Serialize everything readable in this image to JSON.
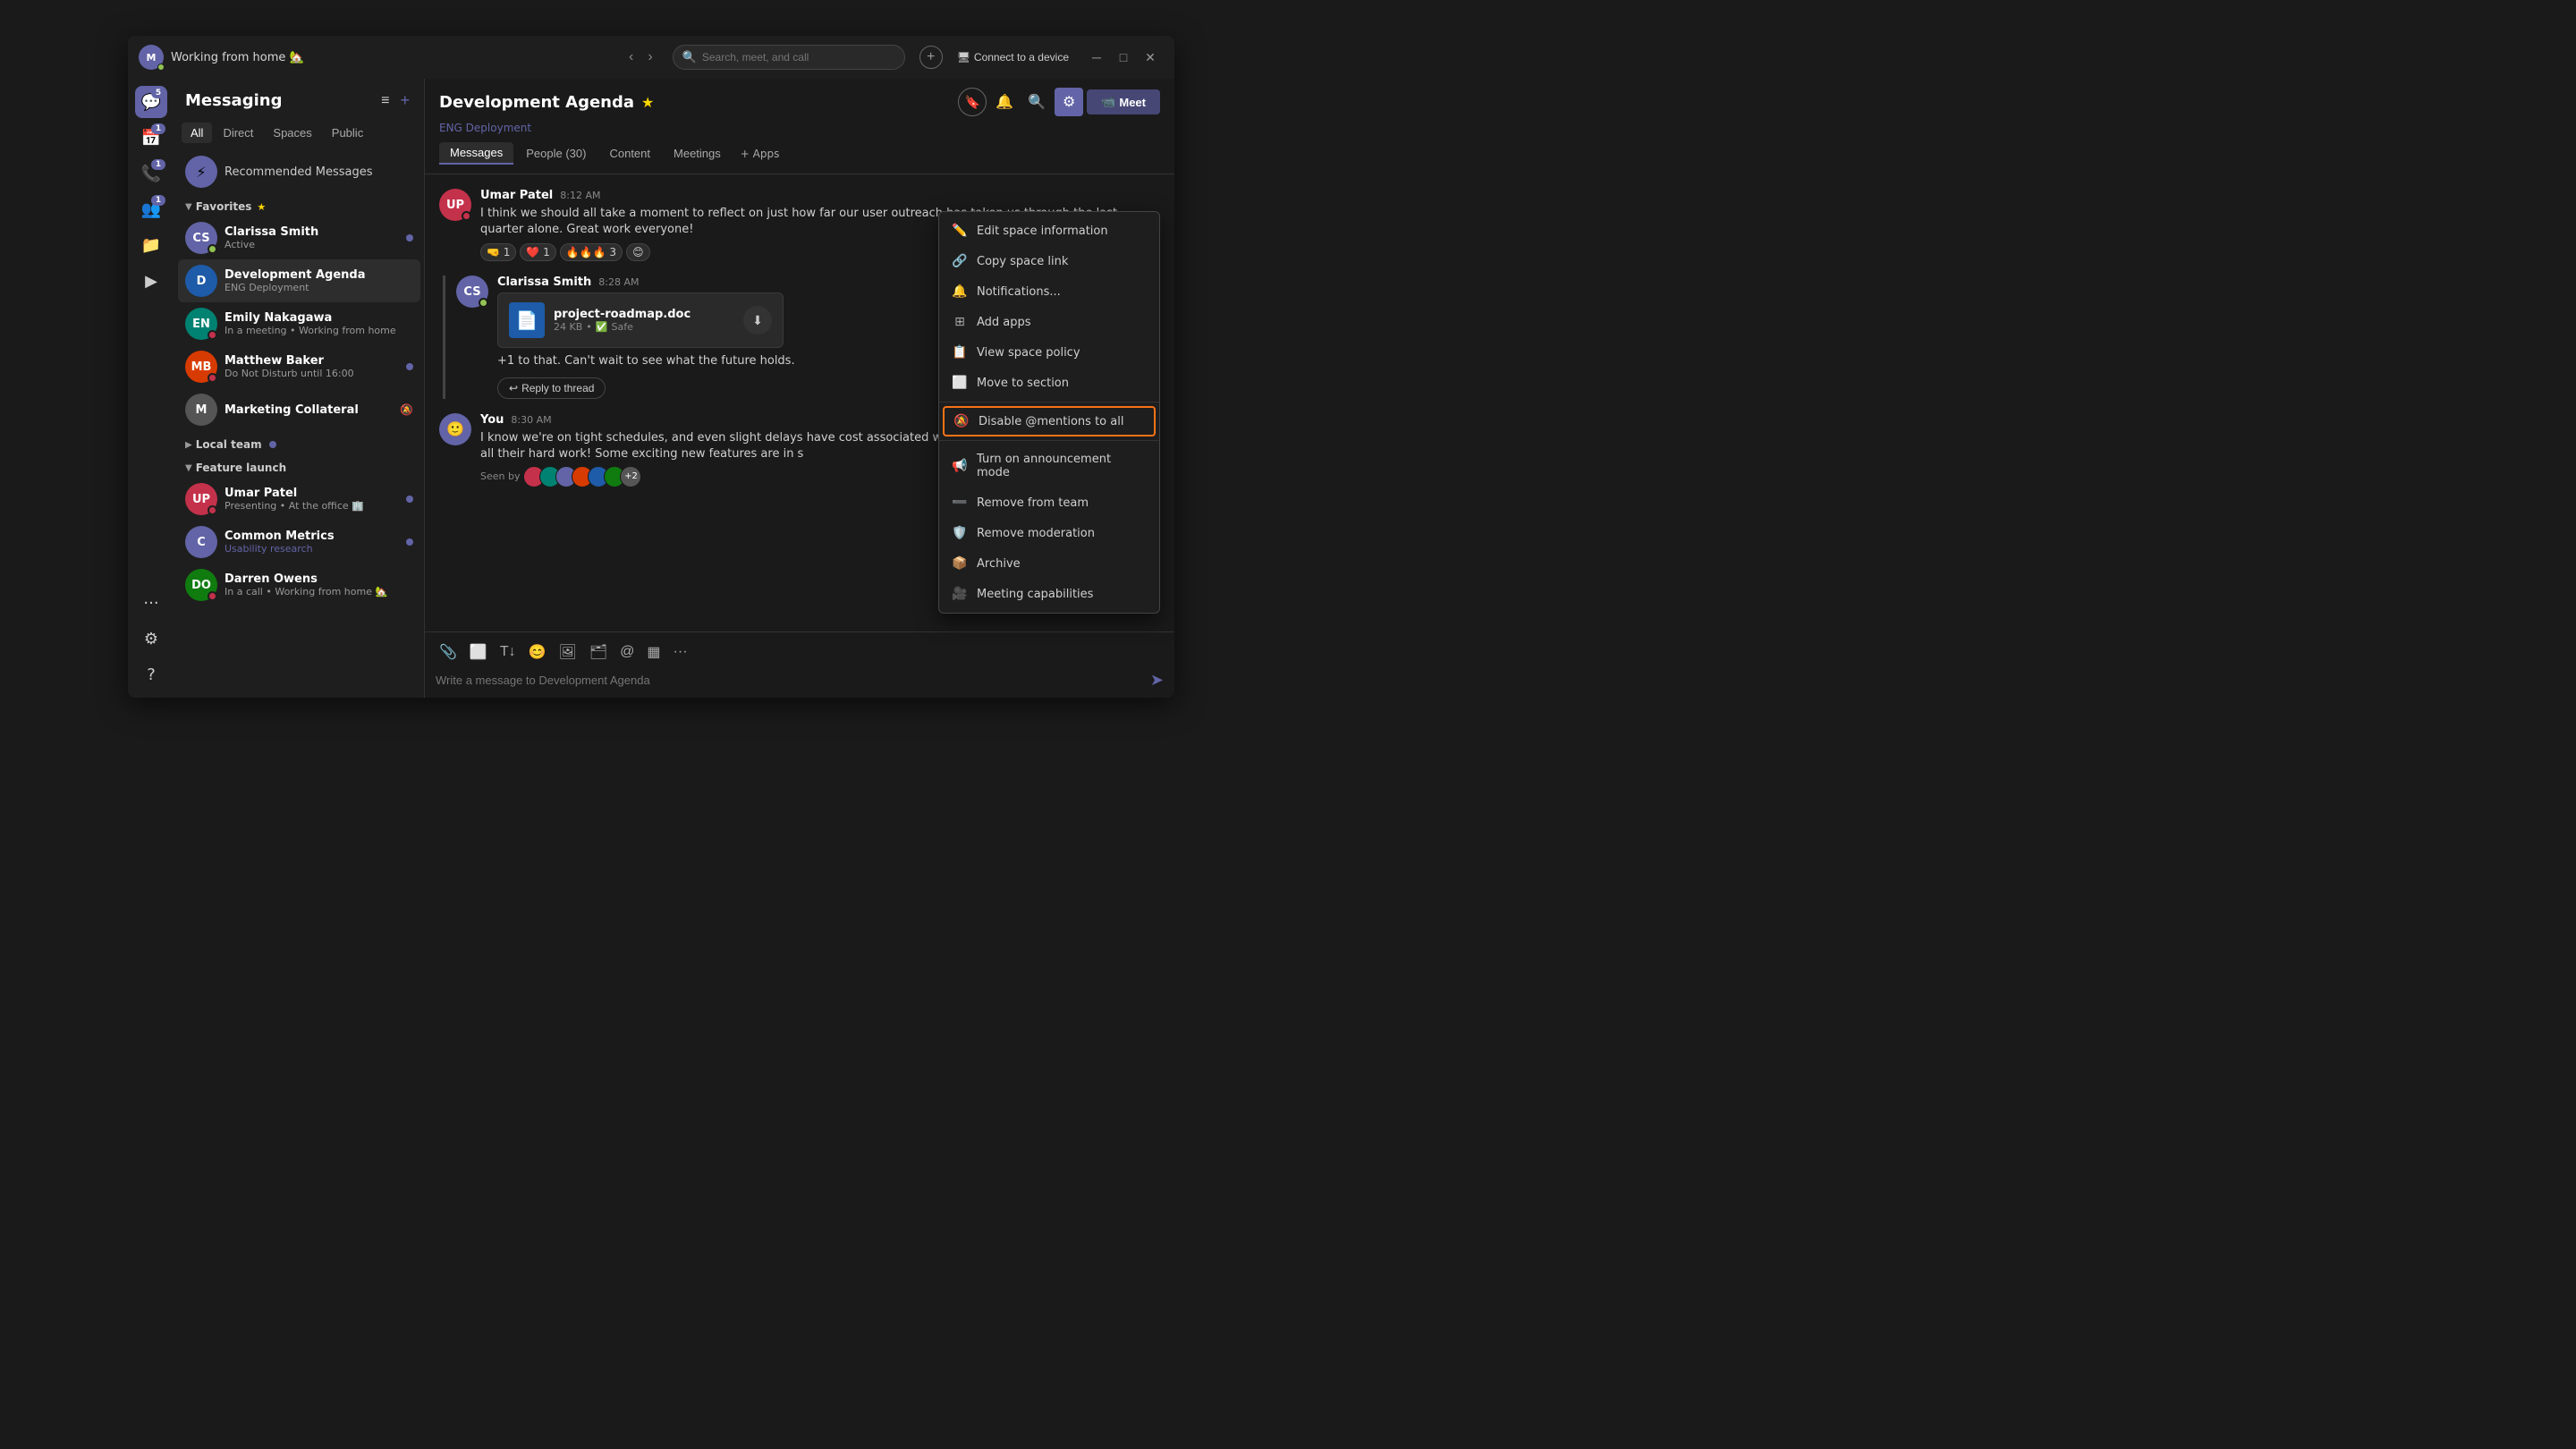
{
  "app": {
    "title": "Working from home 🏡",
    "window_controls": [
      "minimize",
      "maximize",
      "close"
    ],
    "search_placeholder": "Search, meet, and call",
    "connect_device": "Connect to a device"
  },
  "sidebar": {
    "title": "Messaging",
    "tabs": [
      "All",
      "Direct",
      "Spaces",
      "Public"
    ],
    "active_tab": "All",
    "sections": {
      "favorites": {
        "label": "Favorites",
        "expanded": true,
        "star": true
      },
      "local_team": {
        "label": "Local team",
        "expanded": false,
        "has_badge": true
      },
      "feature_launch": {
        "label": "Feature launch",
        "expanded": true
      }
    },
    "recommended": {
      "icon": "⚡",
      "label": "Recommended Messages"
    },
    "items": [
      {
        "id": "clarissa",
        "name": "Clarissa Smith",
        "sub": "Active",
        "avatar_initials": "CS",
        "avatar_color": "av-purple",
        "presence": "available",
        "unread": true,
        "section": "favorites"
      },
      {
        "id": "dev-agenda",
        "name": "Development Agenda",
        "sub": "ENG Deployment",
        "avatar_initials": "D",
        "avatar_color": "av-blue",
        "unread": false,
        "active": true,
        "section": "favorites"
      },
      {
        "id": "emily",
        "name": "Emily Nakagawa",
        "sub": "In a meeting • Working from home",
        "avatar_initials": "EN",
        "avatar_color": "av-teal",
        "presence": "busy",
        "unread": false,
        "section": "favorites"
      },
      {
        "id": "matthew",
        "name": "Matthew Baker",
        "sub": "Do Not Disturb until 16:00",
        "avatar_initials": "MB",
        "avatar_color": "av-orange",
        "presence": "dnd",
        "unread": true,
        "section": "favorites"
      },
      {
        "id": "marketing",
        "name": "Marketing Collateral",
        "sub": "",
        "avatar_initials": "M",
        "avatar_color": "av-gray",
        "muted": true,
        "section": "favorites"
      },
      {
        "id": "umar",
        "name": "Umar Patel",
        "sub": "Presenting • At the office 🏢",
        "avatar_initials": "UP",
        "avatar_color": "av-red",
        "presence": "busy",
        "unread": true,
        "section": "feature_launch"
      },
      {
        "id": "common-metrics",
        "name": "Common Metrics",
        "sub": "Usability research",
        "avatar_initials": "C",
        "avatar_color": "av-purple",
        "unread": true,
        "section": "feature_launch"
      },
      {
        "id": "darren",
        "name": "Darren Owens",
        "sub": "In a call • Working from home 🏡",
        "avatar_initials": "DO",
        "avatar_color": "av-green",
        "presence": "busy",
        "unread": false,
        "section": "feature_launch"
      }
    ]
  },
  "chat": {
    "title": "Development Agenda",
    "subtitle": "ENG Deployment",
    "starred": true,
    "tabs": [
      "Messages",
      "People (30)",
      "Content",
      "Meetings"
    ],
    "active_tab": "Messages",
    "meet_label": "Meet",
    "messages": [
      {
        "id": "msg1",
        "author": "Umar Patel",
        "time": "8:12 AM",
        "text": "I think we should all take a moment to reflect on just how far our user outreach has taken us through the last quarter alone. Great work everyone!",
        "avatar_initials": "UP",
        "avatar_color": "av-red",
        "presence": "busy",
        "reactions": [
          {
            "emoji": "🤜",
            "count": 1
          },
          {
            "emoji": "❤️",
            "count": 1
          },
          {
            "emoji": "🔥🔥🔥",
            "count": 3
          },
          {
            "emoji": "😊",
            "count": null
          }
        ]
      },
      {
        "id": "msg2",
        "author": "Clarissa Smith",
        "time": "8:28 AM",
        "text": "+1 to that. Can't wait to see what the future holds.",
        "avatar_initials": "CS",
        "avatar_color": "av-purple",
        "presence": "available",
        "threaded": true,
        "file": {
          "name": "project-roadmap.doc",
          "size": "24 KB",
          "safe": true,
          "safe_label": "Safe"
        },
        "reply_thread": "Reply to thread"
      },
      {
        "id": "msg3",
        "author": "You",
        "time": "8:30 AM",
        "text": "I know we're on tight schedules, and even slight delays have cost associated with them. Thank you to each team for all their hard work! Some exciting new features are in s",
        "is_you": true,
        "seen_by_label": "Seen by",
        "seen_count": "+2"
      }
    ],
    "input_placeholder": "Write a message to Development Agenda"
  },
  "context_menu": {
    "items": [
      {
        "id": "edit-space",
        "icon": "✏️",
        "label": "Edit space information"
      },
      {
        "id": "copy-link",
        "icon": "🔗",
        "label": "Copy space link"
      },
      {
        "id": "notifications",
        "icon": "🔔",
        "label": "Notifications..."
      },
      {
        "id": "add-apps",
        "icon": "🔲",
        "label": "Add apps"
      },
      {
        "id": "view-policy",
        "icon": "📋",
        "label": "View space policy"
      },
      {
        "id": "move-section",
        "icon": "⬜",
        "label": "Move to section"
      },
      {
        "id": "disable-mentions",
        "icon": "🔕",
        "label": "Disable @mentions to all",
        "highlighted": true
      },
      {
        "id": "announcement",
        "icon": "📢",
        "label": "Turn on announcement mode"
      },
      {
        "id": "remove-team",
        "icon": "➖",
        "label": "Remove from team"
      },
      {
        "id": "remove-moderation",
        "icon": "🛡️",
        "label": "Remove moderation"
      },
      {
        "id": "archive",
        "icon": "📦",
        "label": "Archive"
      },
      {
        "id": "meeting-cap",
        "icon": "🎥",
        "label": "Meeting capabilities"
      }
    ]
  },
  "nav_icons": [
    {
      "id": "chat",
      "symbol": "💬",
      "badge": "5",
      "active": true
    },
    {
      "id": "calendar",
      "symbol": "📅",
      "badge": "1"
    },
    {
      "id": "calls",
      "symbol": "📞",
      "badge": "1"
    },
    {
      "id": "people",
      "symbol": "👥",
      "badge": "1"
    },
    {
      "id": "files",
      "symbol": "📁"
    },
    {
      "id": "apps",
      "symbol": "▶"
    },
    {
      "id": "more",
      "symbol": "···"
    }
  ]
}
